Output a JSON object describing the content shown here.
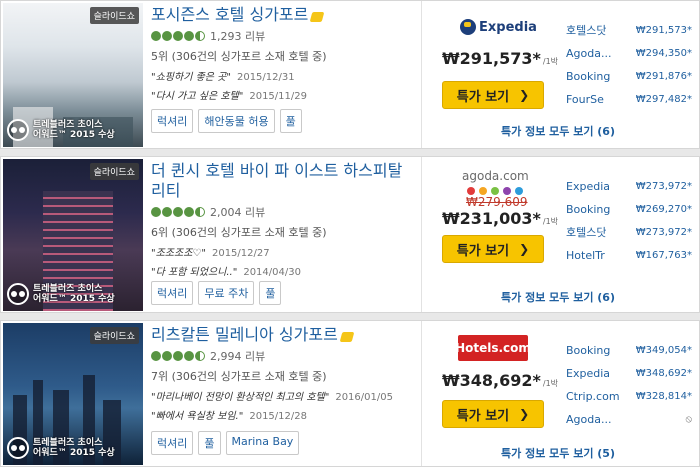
{
  "hotels": [
    {
      "name": "포시즌스 호텔 싱가포르",
      "slideshow_label": "슬라이드쇼",
      "award_line1": "트레블러즈 초이스",
      "award_line2": "어워드™ 2015 수상",
      "bubbles": [
        1,
        1,
        1,
        1,
        0.5
      ],
      "reviews_count": "1,293 리뷰",
      "rank": "5위 (306건의 싱가포르 소재 호텔 중)",
      "quote1": "\"쇼핑하기 좋은 곳\"",
      "date1": "2015/12/31",
      "quote2": "\"다시 가고 싶은 호텔\"",
      "date2": "2015/11/29",
      "chips": [
        "럭셔리",
        "해안동물 허용",
        "풀"
      ],
      "provider": "Expedia",
      "strike_price": "",
      "price": "₩291,573*",
      "per": "/1박",
      "deal_label": "특가 보기",
      "other_offers": [
        {
          "site": "호텔스닷",
          "price": "₩291,573*"
        },
        {
          "site": "Agoda...",
          "price": "₩294,350*"
        },
        {
          "site": "Booking",
          "price": "₩291,876*"
        },
        {
          "site": "FourSe",
          "price": "₩297,482*"
        }
      ],
      "view_all": "특가 정보 모두 보기 (6)"
    },
    {
      "name": "더 퀸시 호텔 바이 파 이스트 하스피탈리티",
      "slideshow_label": "슬라이드쇼",
      "award_line1": "트레블러즈 초이스",
      "award_line2": "어워드™ 2015 수상",
      "bubbles": [
        1,
        1,
        1,
        1,
        0.5
      ],
      "reviews_count": "2,004 리뷰",
      "rank": "6위 (306건의 싱가포르 소재 호텔 중)",
      "quote1": "\"조조조조♡\"",
      "date1": "2015/12/27",
      "quote2": "\"다 포함 되었으니..\"",
      "date2": "2014/04/30",
      "chips": [
        "럭셔리",
        "무료 주차",
        "풀"
      ],
      "provider": "agoda.com",
      "strike_price": "₩279,609",
      "price": "₩231,003*",
      "per": "/1박",
      "deal_label": "특가 보기",
      "other_offers": [
        {
          "site": "Expedia",
          "price": "₩273,972*"
        },
        {
          "site": "Booking",
          "price": "₩269,270*"
        },
        {
          "site": "호텔스닷",
          "price": "₩273,972*"
        },
        {
          "site": "HotelTr",
          "price": "₩167,763*"
        }
      ],
      "view_all": "특가 정보 모두 보기 (6)"
    },
    {
      "name": "리츠칼튼 밀레니아 싱가포르",
      "slideshow_label": "슬라이드쇼",
      "award_line1": "트레블러즈 초이스",
      "award_line2": "어워드™ 2015 수상",
      "bubbles": [
        1,
        1,
        1,
        1,
        0.5
      ],
      "reviews_count": "2,994 리뷰",
      "rank": "7위 (306건의 싱가포르 소재 호텔 중)",
      "quote1": "\"마리나베이 전망이 환상적인 최고의 호텔\"",
      "date1": "2016/01/05",
      "quote2": "\"빠에서 욕실창 보임.\"",
      "date2": "2015/12/28",
      "chips": [
        "럭셔리",
        "풀",
        "Marina Bay"
      ],
      "provider": "Hotels.com",
      "strike_price": "",
      "price": "₩348,692*",
      "per": "/1박",
      "deal_label": "특가 보기",
      "other_offers": [
        {
          "site": "Booking",
          "price": "₩349,054*"
        },
        {
          "site": "Expedia",
          "price": "₩348,692*"
        },
        {
          "site": "Ctrip.com",
          "price": "₩328,814*"
        },
        {
          "site": "Agoda...",
          "price": "⦸"
        }
      ],
      "view_all": "특가 정보 모두 보기 (5)"
    }
  ],
  "colors": {
    "link": "#1f5f9f",
    "deal_button": "#f7c400",
    "bubble": "#589442",
    "strike": "#c0392b"
  }
}
